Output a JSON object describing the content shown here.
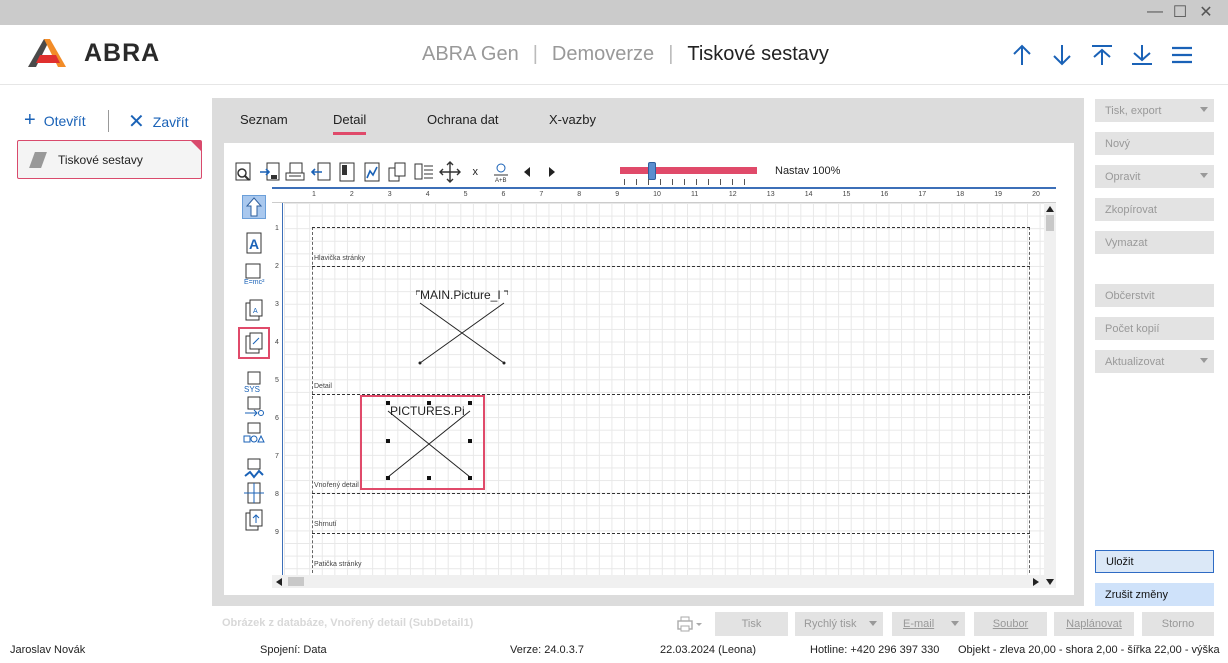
{
  "window": {
    "minimize": "—",
    "maximize": "☐",
    "close": "✕"
  },
  "header": {
    "logo_text": "ABRA",
    "crumb1": "ABRA Gen",
    "crumb2": "Demoverze",
    "crumb3": "Tiskové sestavy",
    "separator": "|"
  },
  "left": {
    "open_label": "Otevřít",
    "close_label": "Zavřít",
    "card_label": "Tiskové sestavy"
  },
  "tabs": [
    {
      "label": "Seznam"
    },
    {
      "label": "Detail"
    },
    {
      "label": "Ochrana dat"
    },
    {
      "label": "X-vazby"
    }
  ],
  "toolbar": {
    "x_label": "x",
    "zoom_label": "Nastav 100%",
    "zoom_fraction": 0.23
  },
  "ruler": {
    "top": [
      "1",
      "2",
      "3",
      "4",
      "5",
      "6",
      "7",
      "8",
      "9",
      "10",
      "11",
      "12",
      "13",
      "14",
      "15",
      "16",
      "17",
      "18",
      "19",
      "20"
    ],
    "left": [
      "1",
      "2",
      "3",
      "4",
      "5",
      "6",
      "7",
      "8",
      "9"
    ]
  },
  "bands": {
    "header": "Hlavička stránky",
    "detail": "Detail",
    "subdetail": "Vnořený detail",
    "summary": "Shrnutí",
    "footer": "Patička stránky"
  },
  "pictures": {
    "main": "MAIN.Picture_I",
    "selected": "PICTURES.Pi"
  },
  "right": {
    "print": "Tisk, export",
    "new": "Nový",
    "edit": "Opravit",
    "copy": "Zkopírovat",
    "delete": "Vymazat",
    "refresh": "Občerstvit",
    "copies": "Počet kopií",
    "update": "Aktualizovat",
    "save": "Uložit",
    "cancel": "Zrušit změny"
  },
  "bottom": {
    "hint": "Obrázek z databáze, Vnořený detail (SubDetail1)",
    "print": "Tisk",
    "quick_print": "Rychlý tisk",
    "email": "E-mail",
    "file": "Soubor",
    "schedule": "Naplánovat",
    "cancel": "Storno"
  },
  "status": {
    "user": "Jaroslav Novák",
    "connection": "Spojení: Data",
    "version": "Verze: 24.0.3.7",
    "date": "22.03.2024 (Leona)",
    "hotline": "Hotline: +420 296 397 330",
    "object": "Objekt - zleva 20,00 - shora 2,00 - šířka 22,00 - výška"
  },
  "colors": {
    "accent": "#e04a6a",
    "blue": "#1a62b7",
    "logo_orange": "#f28c28"
  }
}
